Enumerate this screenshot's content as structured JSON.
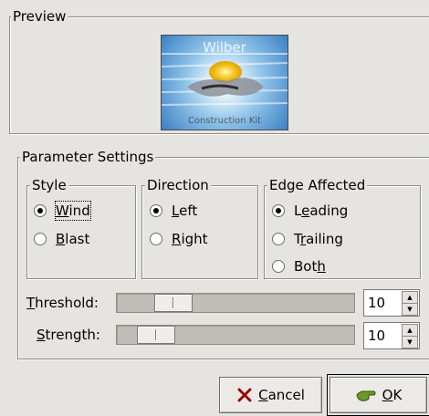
{
  "preview": {
    "title": "Preview",
    "image_top_text": "Wilber",
    "image_bottom_text": "Construction Kit"
  },
  "parameters": {
    "title": "Parameter Settings",
    "style": {
      "title": "Style",
      "options": [
        {
          "label_pre": "",
          "label_u": "W",
          "label_post": "ind",
          "checked": true
        },
        {
          "label_pre": "",
          "label_u": "B",
          "label_post": "last",
          "checked": false
        }
      ]
    },
    "direction": {
      "title": "Direction",
      "options": [
        {
          "label_pre": "",
          "label_u": "L",
          "label_post": "eft",
          "checked": true
        },
        {
          "label_pre": "",
          "label_u": "R",
          "label_post": "ight",
          "checked": false
        }
      ]
    },
    "edge": {
      "title": "Edge Affected",
      "options": [
        {
          "label_pre": "L",
          "label_u": "e",
          "label_post": "ading",
          "checked": true
        },
        {
          "label_pre": "T",
          "label_u": "r",
          "label_post": "ailing",
          "checked": false
        },
        {
          "label_pre": "Bot",
          "label_u": "h",
          "label_post": "",
          "checked": false
        }
      ]
    },
    "threshold": {
      "label_u": "T",
      "label_post": "hreshold:",
      "value": "10",
      "level": 0.19
    },
    "strength": {
      "label_u": "S",
      "label_post": "trength:",
      "value": "10",
      "level": 0.1
    }
  },
  "buttons": {
    "cancel": {
      "label_u": "C",
      "label_post": "ancel"
    },
    "ok": {
      "label_u": "O",
      "label_post": "K"
    }
  },
  "icons": {
    "cancel": "close-x-icon",
    "ok": "ok-hand-icon",
    "spin_up": "arrow-up-icon",
    "spin_down": "arrow-down-icon"
  }
}
